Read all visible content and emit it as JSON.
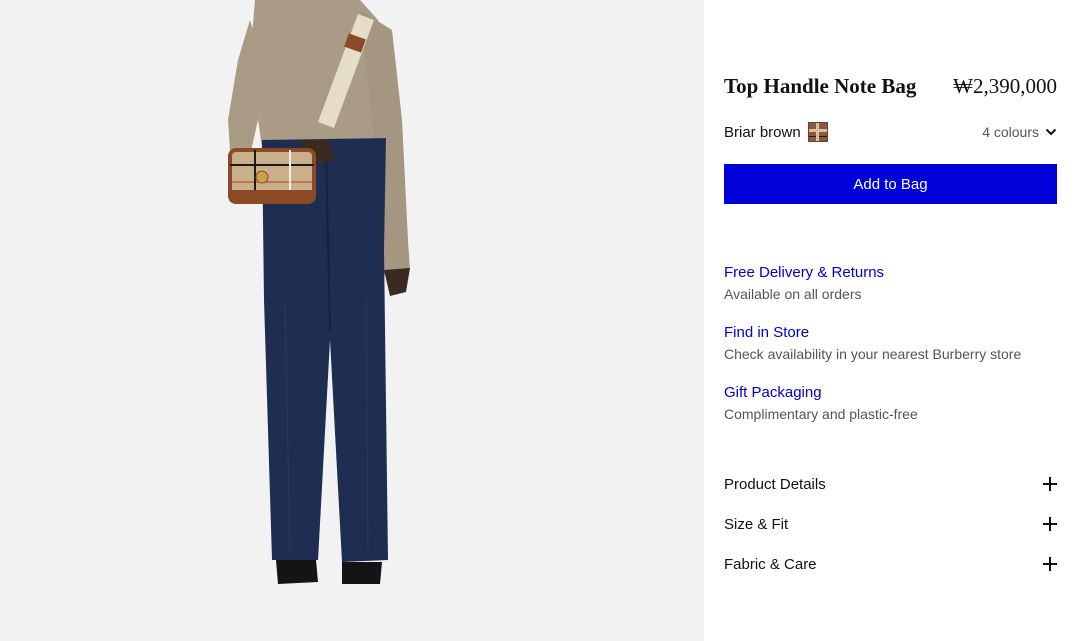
{
  "product": {
    "title": "Top Handle Note Bag",
    "price": "₩2,390,000",
    "colour_name": "Briar brown",
    "colour_count": "4 colours",
    "add_to_bag": "Add to Bag"
  },
  "services": [
    {
      "title": "Free Delivery & Returns",
      "description": "Available on all orders"
    },
    {
      "title": "Find in Store",
      "description": "Check availability in your nearest Burberry store"
    },
    {
      "title": "Gift Packaging",
      "description": "Complimentary and plastic-free"
    }
  ],
  "accordions": [
    {
      "label": "Product Details"
    },
    {
      "label": "Size & Fit"
    },
    {
      "label": "Fabric & Care"
    }
  ],
  "colors": {
    "accent": "#0000d8",
    "link": "#0000c8",
    "image_bg": "#f2f2f2"
  },
  "icons": {
    "colour_toggle": "chevron-down-icon",
    "accordion": "plus-icon"
  }
}
